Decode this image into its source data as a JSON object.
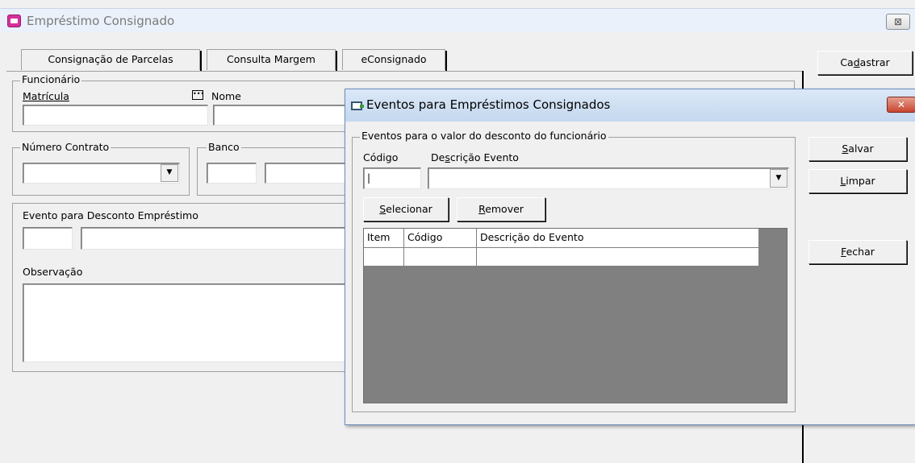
{
  "main_window": {
    "title": "Empréstimo Consignado",
    "close_label": "⊠",
    "tabs": [
      {
        "label": "Consignação de Parcelas"
      },
      {
        "label": "Consulta Margem"
      },
      {
        "label": "eConsignado"
      }
    ],
    "funcionario": {
      "legend": "Funcionário",
      "matricula_label": "Matrícula",
      "nome_label": "Nome",
      "matricula_value": "",
      "nome_value": ""
    },
    "numero_contrato": {
      "legend": "Número Contrato",
      "value": ""
    },
    "banco": {
      "legend": "Banco",
      "code": "",
      "name": ""
    },
    "evento_desconto": {
      "legend": "Evento para Desconto Empréstimo",
      "code": "",
      "description": ""
    },
    "observacao": {
      "label": "Observação",
      "value": ""
    },
    "buttons": {
      "cadastrar": {
        "pre": "Ca",
        "key": "d",
        "post": "astrar"
      }
    }
  },
  "dialog": {
    "title": "Eventos para Empréstimos Consignados",
    "close_label": "✕",
    "group_legend": "Eventos para o valor do desconto do funcionário",
    "codigo_label": "Código",
    "descricao_label": {
      "pre": "De",
      "key": "s",
      "post": "crição Evento"
    },
    "codigo_value": "|",
    "descricao_value": "",
    "buttons": {
      "selecionar": {
        "key": "S",
        "post": "elecionar"
      },
      "remover": {
        "key": "R",
        "post": "emover"
      },
      "salvar": {
        "key": "S",
        "post": "alvar"
      },
      "limpar": {
        "key": "L",
        "post": "impar"
      },
      "fechar": {
        "key": "F",
        "post": "echar"
      }
    },
    "grid": {
      "columns": [
        "Item",
        "Código",
        "Descrição do Evento"
      ],
      "rows": [
        [
          "",
          "",
          ""
        ]
      ]
    }
  }
}
